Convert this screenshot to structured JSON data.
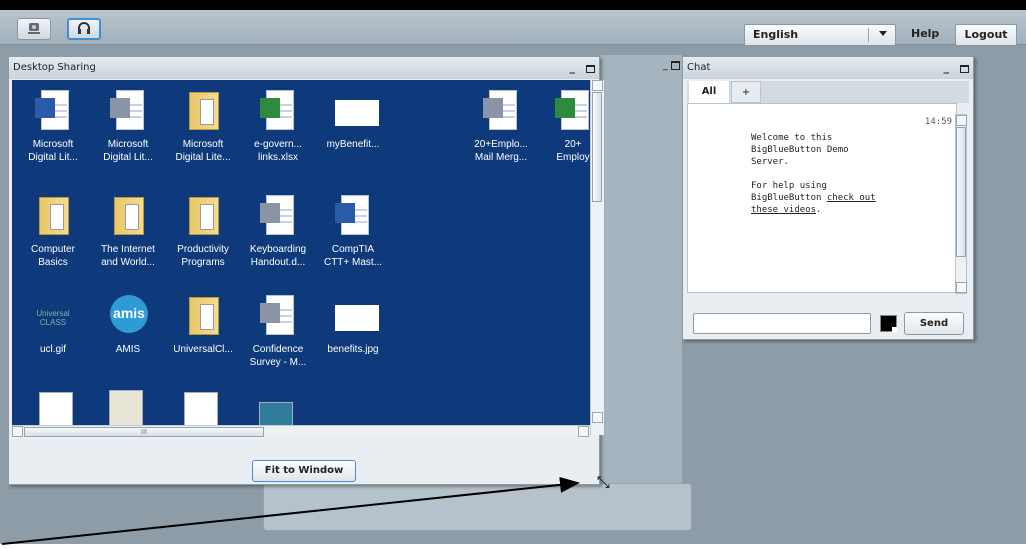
{
  "toolbar": {
    "language": "English",
    "help_label": "Help",
    "logout_label": "Logout",
    "webcam_icon": "webcam-icon",
    "headset_icon": "headset-icon"
  },
  "desktop_sharing": {
    "title": "Desktop Sharing",
    "fit_label": "Fit to Window",
    "scroll_grip": "III",
    "icons": [
      {
        "line1": "Microsoft",
        "line2": "Digital Lit...",
        "kind": "word-doc"
      },
      {
        "line1": "Microsoft",
        "line2": "Digital Lit...",
        "kind": "generic-doc"
      },
      {
        "line1": "Microsoft",
        "line2": "Digital Lite...",
        "kind": "folder"
      },
      {
        "line1": "e-govern...",
        "line2": "links.xlsx",
        "kind": "excel-doc"
      },
      {
        "line1": "myBenefit...",
        "line2": "",
        "kind": "image"
      },
      {
        "line1": "20+Emplo...",
        "line2": "Mail Merg...",
        "kind": "generic-doc"
      },
      {
        "line1": "20+",
        "line2": "Employ",
        "kind": "excel-doc"
      },
      {
        "line1": "Computer",
        "line2": "Basics",
        "kind": "folder"
      },
      {
        "line1": "The Internet",
        "line2": "and World...",
        "kind": "folder"
      },
      {
        "line1": "Productivity",
        "line2": "Programs",
        "kind": "folder"
      },
      {
        "line1": "Keyboarding",
        "line2": "Handout.d...",
        "kind": "generic-doc"
      },
      {
        "line1": "CompTIA",
        "line2": "CTT+ Mast...",
        "kind": "word-doc"
      },
      {
        "line1": "ucl.gif",
        "line2": "",
        "kind": "ucl-image",
        "image_text": "Universal CLASS"
      },
      {
        "line1": "AMIS",
        "line2": "",
        "kind": "amis",
        "image_text": "amis"
      },
      {
        "line1": "UniversalCl...",
        "line2": "",
        "kind": "folder"
      },
      {
        "line1": "Confidence",
        "line2": "Survey - M...",
        "kind": "generic-doc"
      },
      {
        "line1": "benefits.jpg",
        "line2": "",
        "kind": "image"
      }
    ]
  },
  "chat": {
    "title": "Chat",
    "tabs": [
      "All",
      "+"
    ],
    "time": "14:59",
    "message_lines": [
      "Welcome to this",
      "BigBlueButton Demo",
      "Server."
    ],
    "help_lines": [
      "For help using",
      "BigBlueButton "
    ],
    "help_link_1": "check out",
    "help_link_2": "these videos",
    "help_end": ".",
    "input_value": "",
    "send_label": "Send"
  },
  "colors": {
    "desktop_bg": "#0e3a7c",
    "app_bg": "#8e9ca8",
    "word_blue": "#2b5aa8",
    "excel_green": "#2e8b3e"
  }
}
